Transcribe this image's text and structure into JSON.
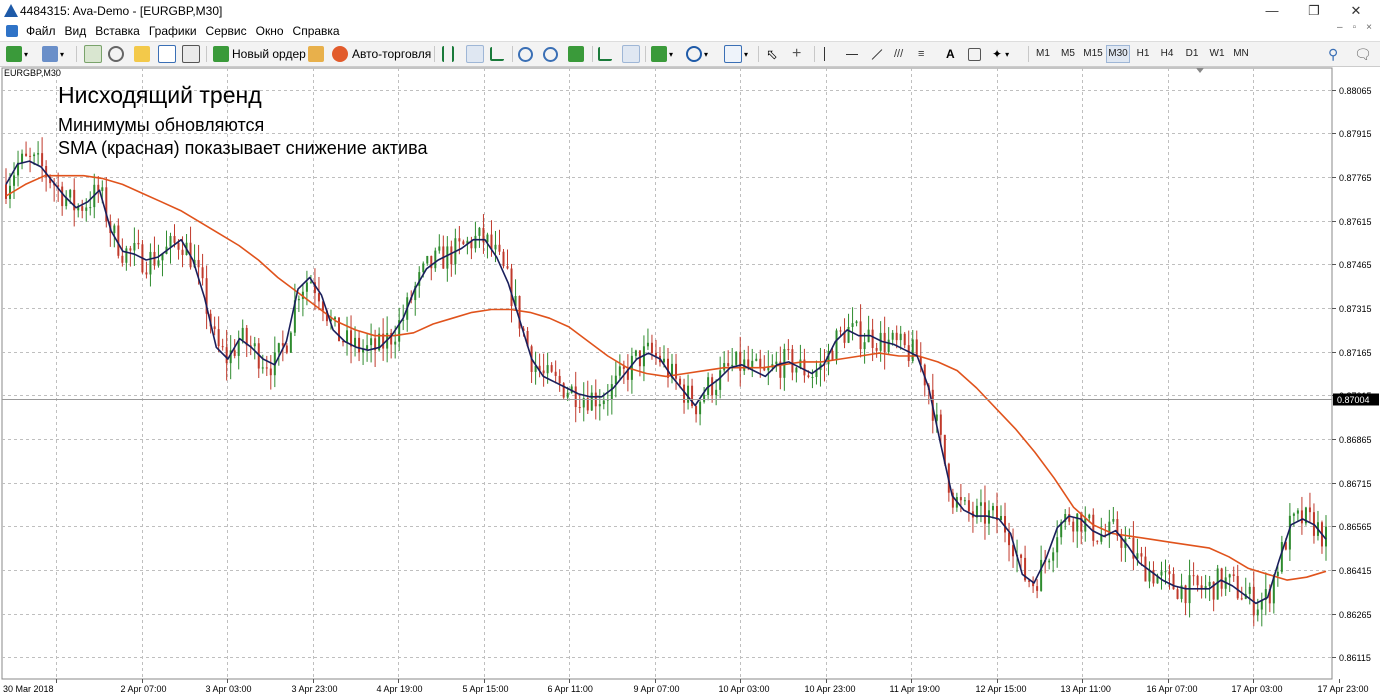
{
  "window": {
    "title": "4484315: Ava-Demo - [EURGBP,M30]",
    "minimize": "—",
    "restore": "❐",
    "close": "✕"
  },
  "menu": {
    "items": [
      "Файл",
      "Вид",
      "Вставка",
      "Графики",
      "Сервис",
      "Окно",
      "Справка"
    ]
  },
  "toolbar": {
    "new_order_label": "Новый ордер",
    "auto_trading_label": "Авто-торговля",
    "text_tool": "A",
    "timeframes": [
      "M1",
      "M5",
      "M15",
      "M30",
      "H1",
      "H4",
      "D1",
      "W1",
      "MN"
    ],
    "active_timeframe": "M30"
  },
  "chart": {
    "symbol_label": "EURGBP,M30",
    "annotation_title": "Нисходящий тренд",
    "annotation_line1": "Минимумы обновляются",
    "annotation_line2": "SMA (красная) показывает снижение актива",
    "current_price": "0.87004"
  },
  "colors": {
    "bull": "#2e8b2e",
    "bear": "#c0392b",
    "sma": "#e0531c",
    "fast_ma": "#1a1f5c",
    "grid": "#bfbfbf",
    "price_tag_bg": "#000000"
  },
  "chart_data": {
    "type": "line",
    "title": "",
    "xlabel": "",
    "ylabel": "",
    "ylim": [
      0.8604,
      0.8814
    ],
    "y_ticks": [
      "0.88065",
      "0.87915",
      "0.87765",
      "0.87615",
      "0.87465",
      "0.87315",
      "0.87165",
      "0.87015",
      "0.86865",
      "0.86715",
      "0.86565",
      "0.86415",
      "0.86265",
      "0.86115"
    ],
    "x_ticks": [
      "30 Mar 2018",
      "2 Apr 07:00",
      "3 Apr 03:00",
      "3 Apr 23:00",
      "4 Apr 19:00",
      "5 Apr 15:00",
      "6 Apr 11:00",
      "9 Apr 07:00",
      "10 Apr 03:00",
      "10 Apr 23:00",
      "11 Apr 19:00",
      "12 Apr 15:00",
      "13 Apr 11:00",
      "16 Apr 07:00",
      "17 Apr 03:00",
      "17 Apr 23:00"
    ],
    "grid": true,
    "series": [
      {
        "name": "",
        "values": [
          0.8774,
          0.8781,
          0.8782,
          0.878,
          0.8775,
          0.877,
          0.8766,
          0.8768,
          0.8772,
          0.8758,
          0.8751,
          0.875,
          0.8748,
          0.8749,
          0.8752,
          0.8755,
          0.8748,
          0.8735,
          0.8718,
          0.8714,
          0.8721,
          0.8718,
          0.8714,
          0.8712,
          0.872,
          0.8738,
          0.8742,
          0.8736,
          0.8724,
          0.872,
          0.8718,
          0.8717,
          0.8718,
          0.8722,
          0.8728,
          0.8738,
          0.8745,
          0.8748,
          0.875,
          0.8752,
          0.8755,
          0.8755,
          0.8749,
          0.874,
          0.8727,
          0.8714,
          0.8708,
          0.8706,
          0.8704,
          0.8702,
          0.8701,
          0.8701,
          0.8704,
          0.8709,
          0.8714,
          0.8716,
          0.8714,
          0.8708,
          0.8703,
          0.8698,
          0.8704,
          0.8707,
          0.8711,
          0.8712,
          0.871,
          0.8708,
          0.8712,
          0.8713,
          0.8711,
          0.8709,
          0.8712,
          0.872,
          0.8724,
          0.8722,
          0.8722,
          0.872,
          0.8719,
          0.8717,
          0.8715,
          0.8704,
          0.8685,
          0.8667,
          0.8662,
          0.866,
          0.866,
          0.8659,
          0.8654,
          0.864,
          0.8637,
          0.8645,
          0.8656,
          0.866,
          0.8659,
          0.8655,
          0.8653,
          0.8655,
          0.865,
          0.8644,
          0.8641,
          0.8638,
          0.8636,
          0.8635,
          0.8635,
          0.8635,
          0.8638,
          0.8636,
          0.8633,
          0.863,
          0.8632,
          0.8645,
          0.8657,
          0.8659,
          0.8657,
          0.8652
        ]
      },
      {
        "name": "SMA",
        "values": [
          0.877,
          0.8774,
          0.8777,
          0.8777,
          0.8777,
          0.8776,
          0.8774,
          0.8771,
          0.8768,
          0.8765,
          0.8761,
          0.8757,
          0.8753,
          0.8748,
          0.8742,
          0.8737,
          0.8732,
          0.8727,
          0.8724,
          0.8722,
          0.8722,
          0.8723,
          0.8726,
          0.8728,
          0.873,
          0.8731,
          0.8731,
          0.873,
          0.8728,
          0.8725,
          0.872,
          0.8715,
          0.8711,
          0.8709,
          0.8708,
          0.8709,
          0.871,
          0.8711,
          0.8711,
          0.8711,
          0.8712,
          0.8713,
          0.8713,
          0.8714,
          0.8715,
          0.8716,
          0.8715,
          0.8715,
          0.8713,
          0.871,
          0.8704,
          0.8697,
          0.869,
          0.8682,
          0.8673,
          0.8663,
          0.8657,
          0.8654,
          0.8653,
          0.8652,
          0.8651,
          0.865,
          0.8649,
          0.8646,
          0.8642,
          0.864,
          0.8638,
          0.8639,
          0.8641
        ]
      }
    ]
  }
}
